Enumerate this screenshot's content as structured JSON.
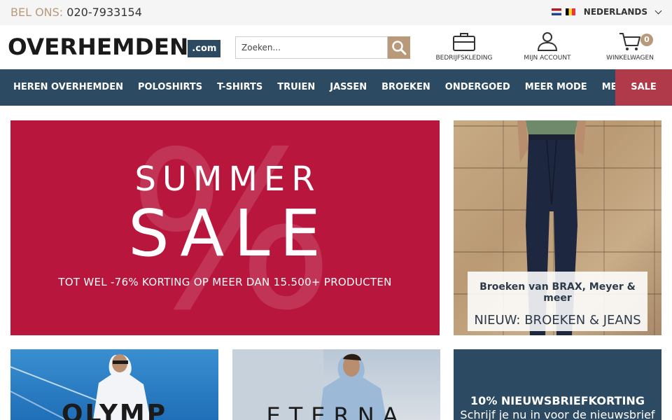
{
  "topbar": {
    "phone_label": "BEL ONS:",
    "phone_number": "020-7933154",
    "language": "NEDERLANDS"
  },
  "header": {
    "logo_text": "OVERHEMDEN",
    "logo_suffix": ".com",
    "search_placeholder": "Zoeken...",
    "icons": {
      "business": "BEDRIJFSKLEDING",
      "account": "MIJN ACCOUNT",
      "cart": "WINKELWAGEN",
      "cart_count": "0"
    }
  },
  "nav": {
    "items": [
      "HEREN OVERHEMDEN",
      "POLOSHIRTS",
      "T-SHIRTS",
      "TRUIEN",
      "JASSEN",
      "BROEKEN",
      "ONDERGOED",
      "MEER MODE",
      "MERKEN"
    ],
    "sale": "SALE"
  },
  "hero": {
    "percent_glyph": "%",
    "line1": "SUMMER",
    "line2": "SALE",
    "subtitle": "TOT WEL -76% KORTING OP MEER DAN 15.500+ PRODUCTEN"
  },
  "pants_banner": {
    "title": "Broeken van BRAX, Meyer & meer",
    "subtitle": "NIEUW: BROEKEN & JEANS"
  },
  "tiles": {
    "olymp": "OLYMP",
    "eterna": "ETERNA",
    "news_title": "10% NIEUWSBRIEFKORTING",
    "news_text": "Schrijf je nu in voor de nieuwsbrief"
  },
  "colors": {
    "navy": "#2d4a63",
    "accent_tan": "#b89a7a",
    "hero_red": "#b8163c",
    "sale_red": "#b03a4a"
  }
}
